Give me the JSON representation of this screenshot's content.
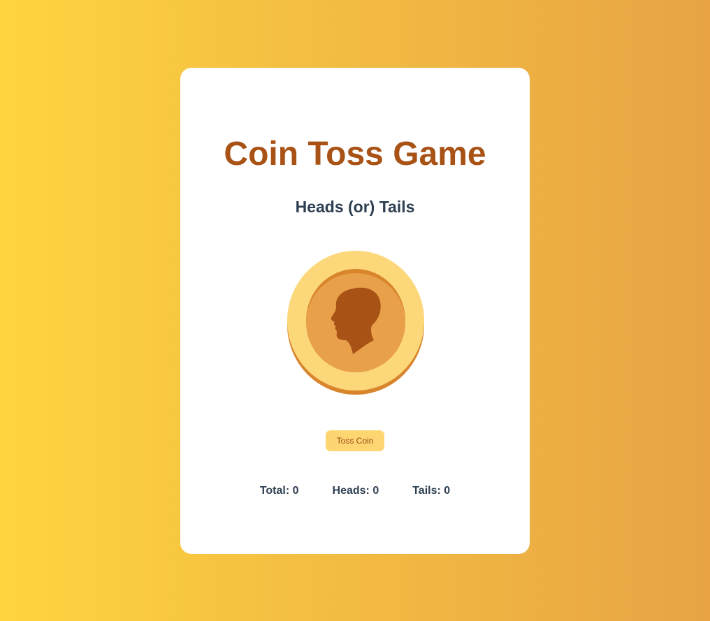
{
  "page": {
    "title": "Coin Toss Game",
    "subtitle": "Heads (or) Tails"
  },
  "coin": {
    "face": "heads",
    "icon": "head-silhouette-icon"
  },
  "controls": {
    "toss_label": "Toss Coin"
  },
  "stats": {
    "total": "Total: 0",
    "heads": "Heads: 0",
    "tails": "Tails: 0"
  },
  "colors": {
    "background_start": "#ffd43f",
    "background_end": "#e8a444",
    "title": "#a85216",
    "subtitle": "#2e3f52",
    "coin_outer": "#fdd87a",
    "coin_inner": "#e8a04a",
    "coin_edge": "#d9852c",
    "silhouette": "#a85216",
    "button_bg": "#fdd672",
    "button_text": "#9b4a17"
  }
}
